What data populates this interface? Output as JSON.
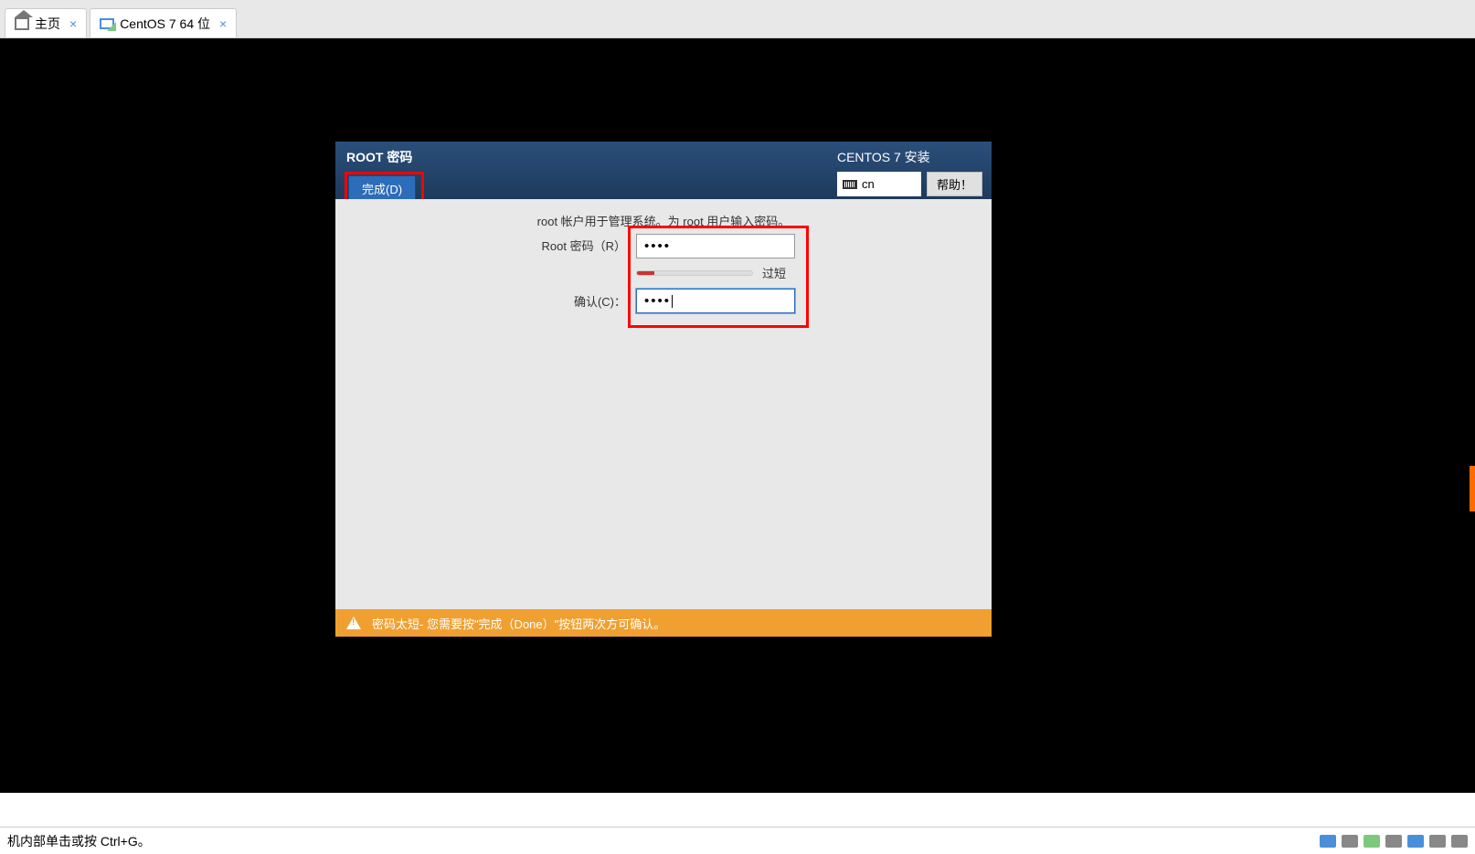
{
  "tabs": {
    "home_label": "主页",
    "vm_label": "CentOS 7 64 位"
  },
  "installer": {
    "header_title": "ROOT 密码",
    "done_button": "完成(D)",
    "install_title": "CENTOS 7 安装",
    "lang_code": "cn",
    "help_button": "帮助！",
    "instruction": "root 帐户用于管理系统。为 root 用户输入密码。",
    "root_pw_label": "Root 密码（R）",
    "confirm_label": "确认(C)：",
    "password_value": "••••",
    "confirm_value": "••••",
    "strength_label": "过短",
    "warning_text": "密码太短- 您需要按\"完成（Done）\"按钮两次方可确认。"
  },
  "status": {
    "hint": "机内部单击或按 Ctrl+G。"
  }
}
